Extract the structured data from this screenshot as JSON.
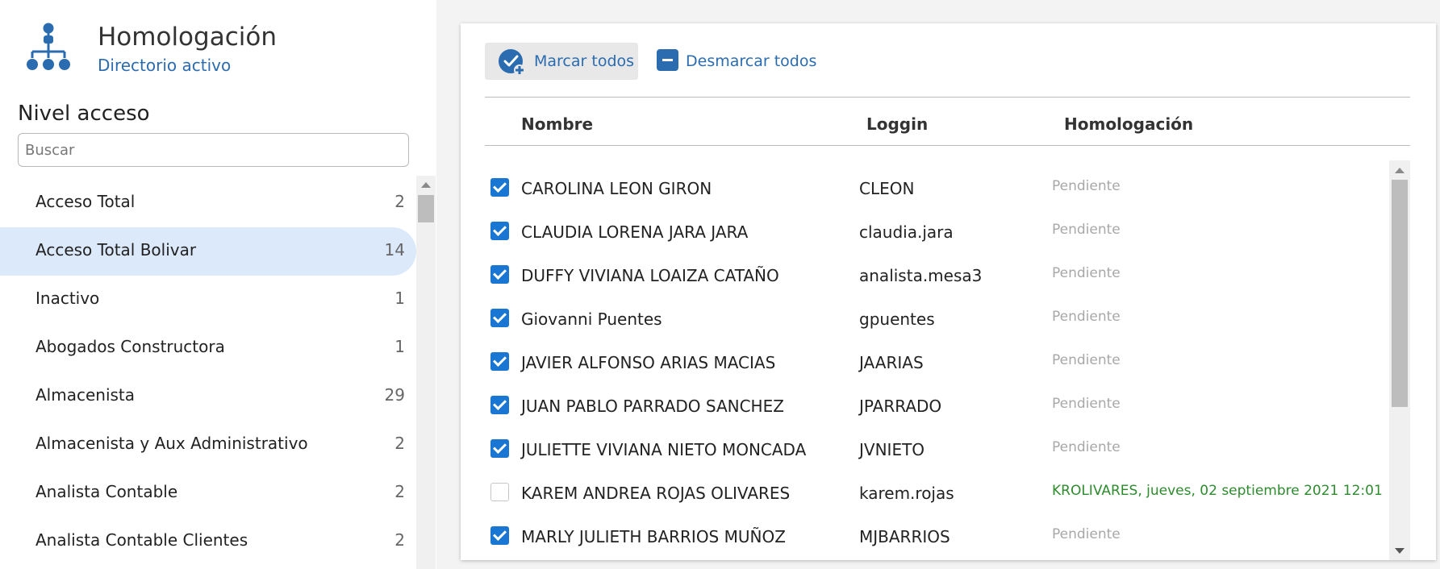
{
  "app": {
    "title": "Homologación",
    "subtitle": "Directorio activo",
    "logo_icon": "org-chart-icon",
    "accent_color": "#2b6cb0"
  },
  "sidebar": {
    "section_title": "Nivel acceso",
    "search_placeholder": "Buscar",
    "selected_index": 1,
    "items": [
      {
        "label": "Acceso Total",
        "count": "2"
      },
      {
        "label": "Acceso Total Bolivar",
        "count": "14"
      },
      {
        "label": "Inactivo",
        "count": "1"
      },
      {
        "label": "Abogados Constructora",
        "count": "1"
      },
      {
        "label": "Almacenista",
        "count": "29"
      },
      {
        "label": "Almacenista y Aux Administrativo",
        "count": "2"
      },
      {
        "label": "Analista Contable",
        "count": "2"
      },
      {
        "label": "Analista Contable Clientes",
        "count": "2"
      }
    ]
  },
  "toolbar": {
    "mark_all_label": "Marcar todos",
    "unmark_all_label": "Desmarcar todos"
  },
  "table": {
    "columns": {
      "name": "Nombre",
      "login": "Loggin",
      "status": "Homologación"
    },
    "rows": [
      {
        "checked": true,
        "name": "CAROLINA LEON GIRON",
        "login": "CLEON",
        "status": "Pendiente",
        "done": false
      },
      {
        "checked": true,
        "name": "CLAUDIA LORENA JARA JARA",
        "login": "claudia.jara",
        "status": "Pendiente",
        "done": false
      },
      {
        "checked": true,
        "name": "DUFFY VIVIANA LOAIZA CATAÑO",
        "login": "analista.mesa3",
        "status": "Pendiente",
        "done": false
      },
      {
        "checked": true,
        "name": "Giovanni Puentes",
        "login": "gpuentes",
        "status": "Pendiente",
        "done": false
      },
      {
        "checked": true,
        "name": "JAVIER ALFONSO ARIAS MACIAS",
        "login": "JAARIAS",
        "status": "Pendiente",
        "done": false
      },
      {
        "checked": true,
        "name": "JUAN PABLO PARRADO SANCHEZ",
        "login": "JPARRADO",
        "status": "Pendiente",
        "done": false
      },
      {
        "checked": true,
        "name": "JULIETTE VIVIANA NIETO MONCADA",
        "login": "JVNIETO",
        "status": "Pendiente",
        "done": false
      },
      {
        "checked": false,
        "name": "KAREM ANDREA ROJAS OLIVARES",
        "login": "karem.rojas",
        "status": "KROLIVARES, jueves, 02 septiembre 2021 12:01",
        "done": true
      },
      {
        "checked": true,
        "name": "MARLY JULIETH BARRIOS MUÑOZ",
        "login": "MJBARRIOS",
        "status": "Pendiente",
        "done": false
      }
    ]
  }
}
